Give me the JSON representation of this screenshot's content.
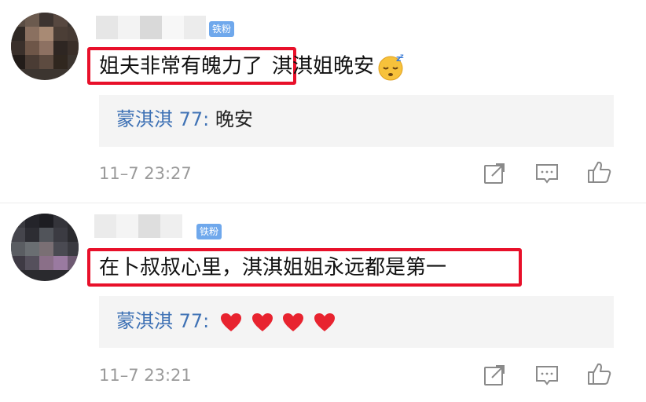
{
  "comments": [
    {
      "badge": "铁粉",
      "text_highlighted": "姐夫非常有魄力了",
      "text_rest": "淇淇姐晚安",
      "emoji": "sleeping-face",
      "reply": {
        "user": "蒙淇淇 77",
        "separator": ": ",
        "body": "晚安"
      },
      "time": "11–7 23:27"
    },
    {
      "badge": "铁粉",
      "text_highlighted": "在卜叔叔心里，淇淇姐姐永远都是第一",
      "text_rest": "",
      "reply": {
        "user": "蒙淇淇 77",
        "separator": ": ",
        "body": "",
        "hearts": [
          "red-heart",
          "red-heart",
          "red-heart",
          "red-heart"
        ]
      },
      "time": "11–7 23:21"
    }
  ],
  "actions": [
    "share-icon",
    "comment-icon",
    "like-icon"
  ],
  "colors": {
    "highlight": "#e8102a",
    "badge": "#6fa8ec",
    "reply_user": "#3f72b5",
    "reply_bg": "#f4f4f4",
    "time": "#9a9a9a"
  }
}
